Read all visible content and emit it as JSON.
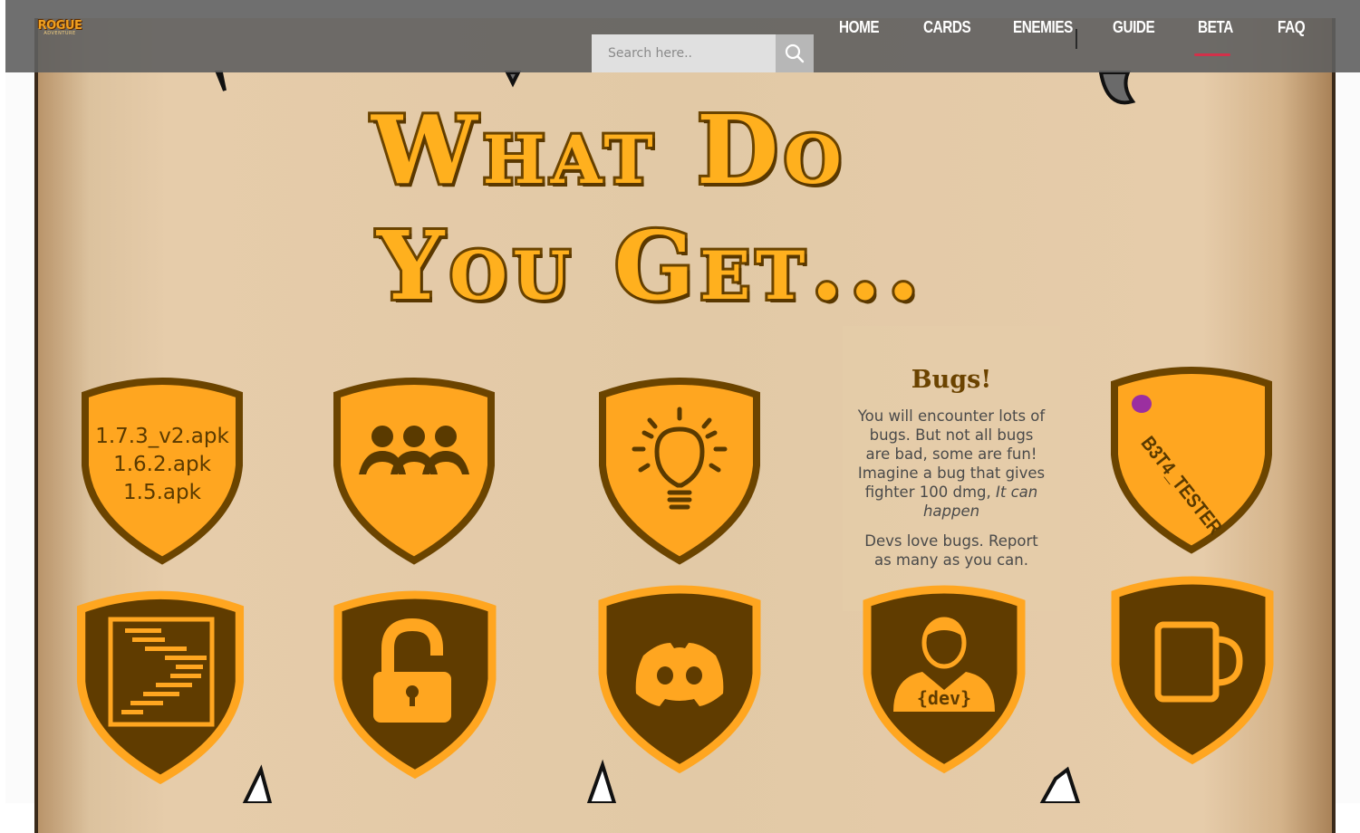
{
  "header": {
    "logo": {
      "main": "ROGUE",
      "sub": "ADVENTURE"
    },
    "search": {
      "placeholder": "Search here.."
    },
    "nav": [
      {
        "label": "HOME"
      },
      {
        "label": "CARDS"
      },
      {
        "label": "ENEMIES"
      },
      {
        "label": "GUIDE"
      },
      {
        "label": "BETA",
        "active": true
      },
      {
        "label": "FAQ"
      }
    ]
  },
  "main": {
    "title_line1": "What Do",
    "title_line2": "You Get...",
    "apk_versions": [
      "1.7.3_v2.apk",
      "1.6.2.apk",
      "1.5.apk"
    ],
    "bugs": {
      "title": "Bugs!",
      "paragraph1": "You will encounter lots of bugs. But not all bugs are bad, some are fun! Imagine a bug that gives fighter 100 dmg,",
      "paragraph1_italic": "It can happen",
      "paragraph2": "Devs love bugs. Report as many as you can."
    },
    "tester_tag": "B3T4_TESTER",
    "dev_label": "{dev}",
    "icons": [
      "apk-files-badge",
      "community-icon",
      "lightbulb-icon",
      "tester-tag-icon",
      "code-file-icon",
      "unlocked-padlock-icon",
      "discord-icon",
      "developer-icon",
      "mug-icon"
    ]
  },
  "colors": {
    "header_bg": "#5f5f5f",
    "badge_orange": "#ffa620",
    "badge_brown": "#6b4400",
    "dark_badge_bg": "#603c00",
    "parchment": "#e2c9a6",
    "accent_underline": "#d2314a",
    "bugs_title": "#6b4300"
  }
}
